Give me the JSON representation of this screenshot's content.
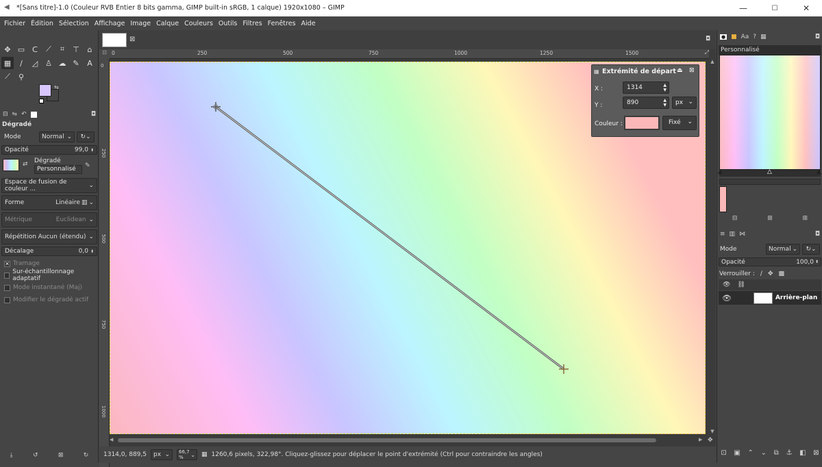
{
  "window": {
    "title": "*[Sans titre]-1.0 (Couleur RVB Entier 8 bits gamma, GIMP built-in sRGB, 1 calque) 1920x1080 – GIMP",
    "minimize": "—",
    "maximize": "☐",
    "close": "✕"
  },
  "menu": [
    "Fichier",
    "Édition",
    "Sélection",
    "Affichage",
    "Image",
    "Calque",
    "Couleurs",
    "Outils",
    "Filtres",
    "Fenêtres",
    "Aide"
  ],
  "tool_options": {
    "title": "Dégradé",
    "mode_label": "Mode",
    "mode_value": "Normal",
    "opacity_label": "Opacité",
    "opacity_value": "99,0",
    "gradient_label": "Dégradé",
    "gradient_name": "Personnalisé",
    "blend_space": "Espace de fusion de couleur ...",
    "shape_label": "Forme",
    "shape_value": "Linéaire",
    "metric_label": "Métrique",
    "metric_value": "Euclidean",
    "repeat_label": "Répétition",
    "repeat_value": "Aucun (étendu)",
    "offset_label": "Décalage",
    "offset_value": "0,0",
    "dither": "Tramage",
    "supersample": "Sur-échantillonnage adaptatif",
    "instant": "Mode instantané (Maj)",
    "modify_active": "Modifier le dégradé actif"
  },
  "ruler": {
    "top": [
      "0",
      "250",
      "500",
      "750",
      "1000",
      "1250",
      "1500"
    ],
    "left": [
      "0",
      "250",
      "500",
      "750",
      "1000"
    ]
  },
  "endpoint_dialog": {
    "title": "Extrémité de départ",
    "x_label": "X :",
    "x_value": "1314",
    "y_label": "Y :",
    "y_value": "890",
    "unit": "px",
    "color_label": "Couleur :",
    "color_swatch": "#fbb8b8",
    "color_mode": "Fixé"
  },
  "status": {
    "coords": "1314,0, 889,5",
    "unit": "px",
    "zoom": "66,7 %",
    "message": "1260,6 pixels, 322,98°. Cliquez-glissez pour déplacer le point d'extrémité (Ctrl pour contraindre les angles)"
  },
  "gradients_panel": {
    "name": "Personnalisé"
  },
  "layers_panel": {
    "mode_label": "Mode",
    "mode_value": "Normal",
    "opacity_label": "Opacité",
    "opacity_value": "100,0",
    "lock_label": "Verrouiller :",
    "layer_name": "Arrière-plan"
  },
  "colors": {
    "fg": "#d8c6ff",
    "bg": "#ffffff",
    "accent": "#e8d840"
  }
}
